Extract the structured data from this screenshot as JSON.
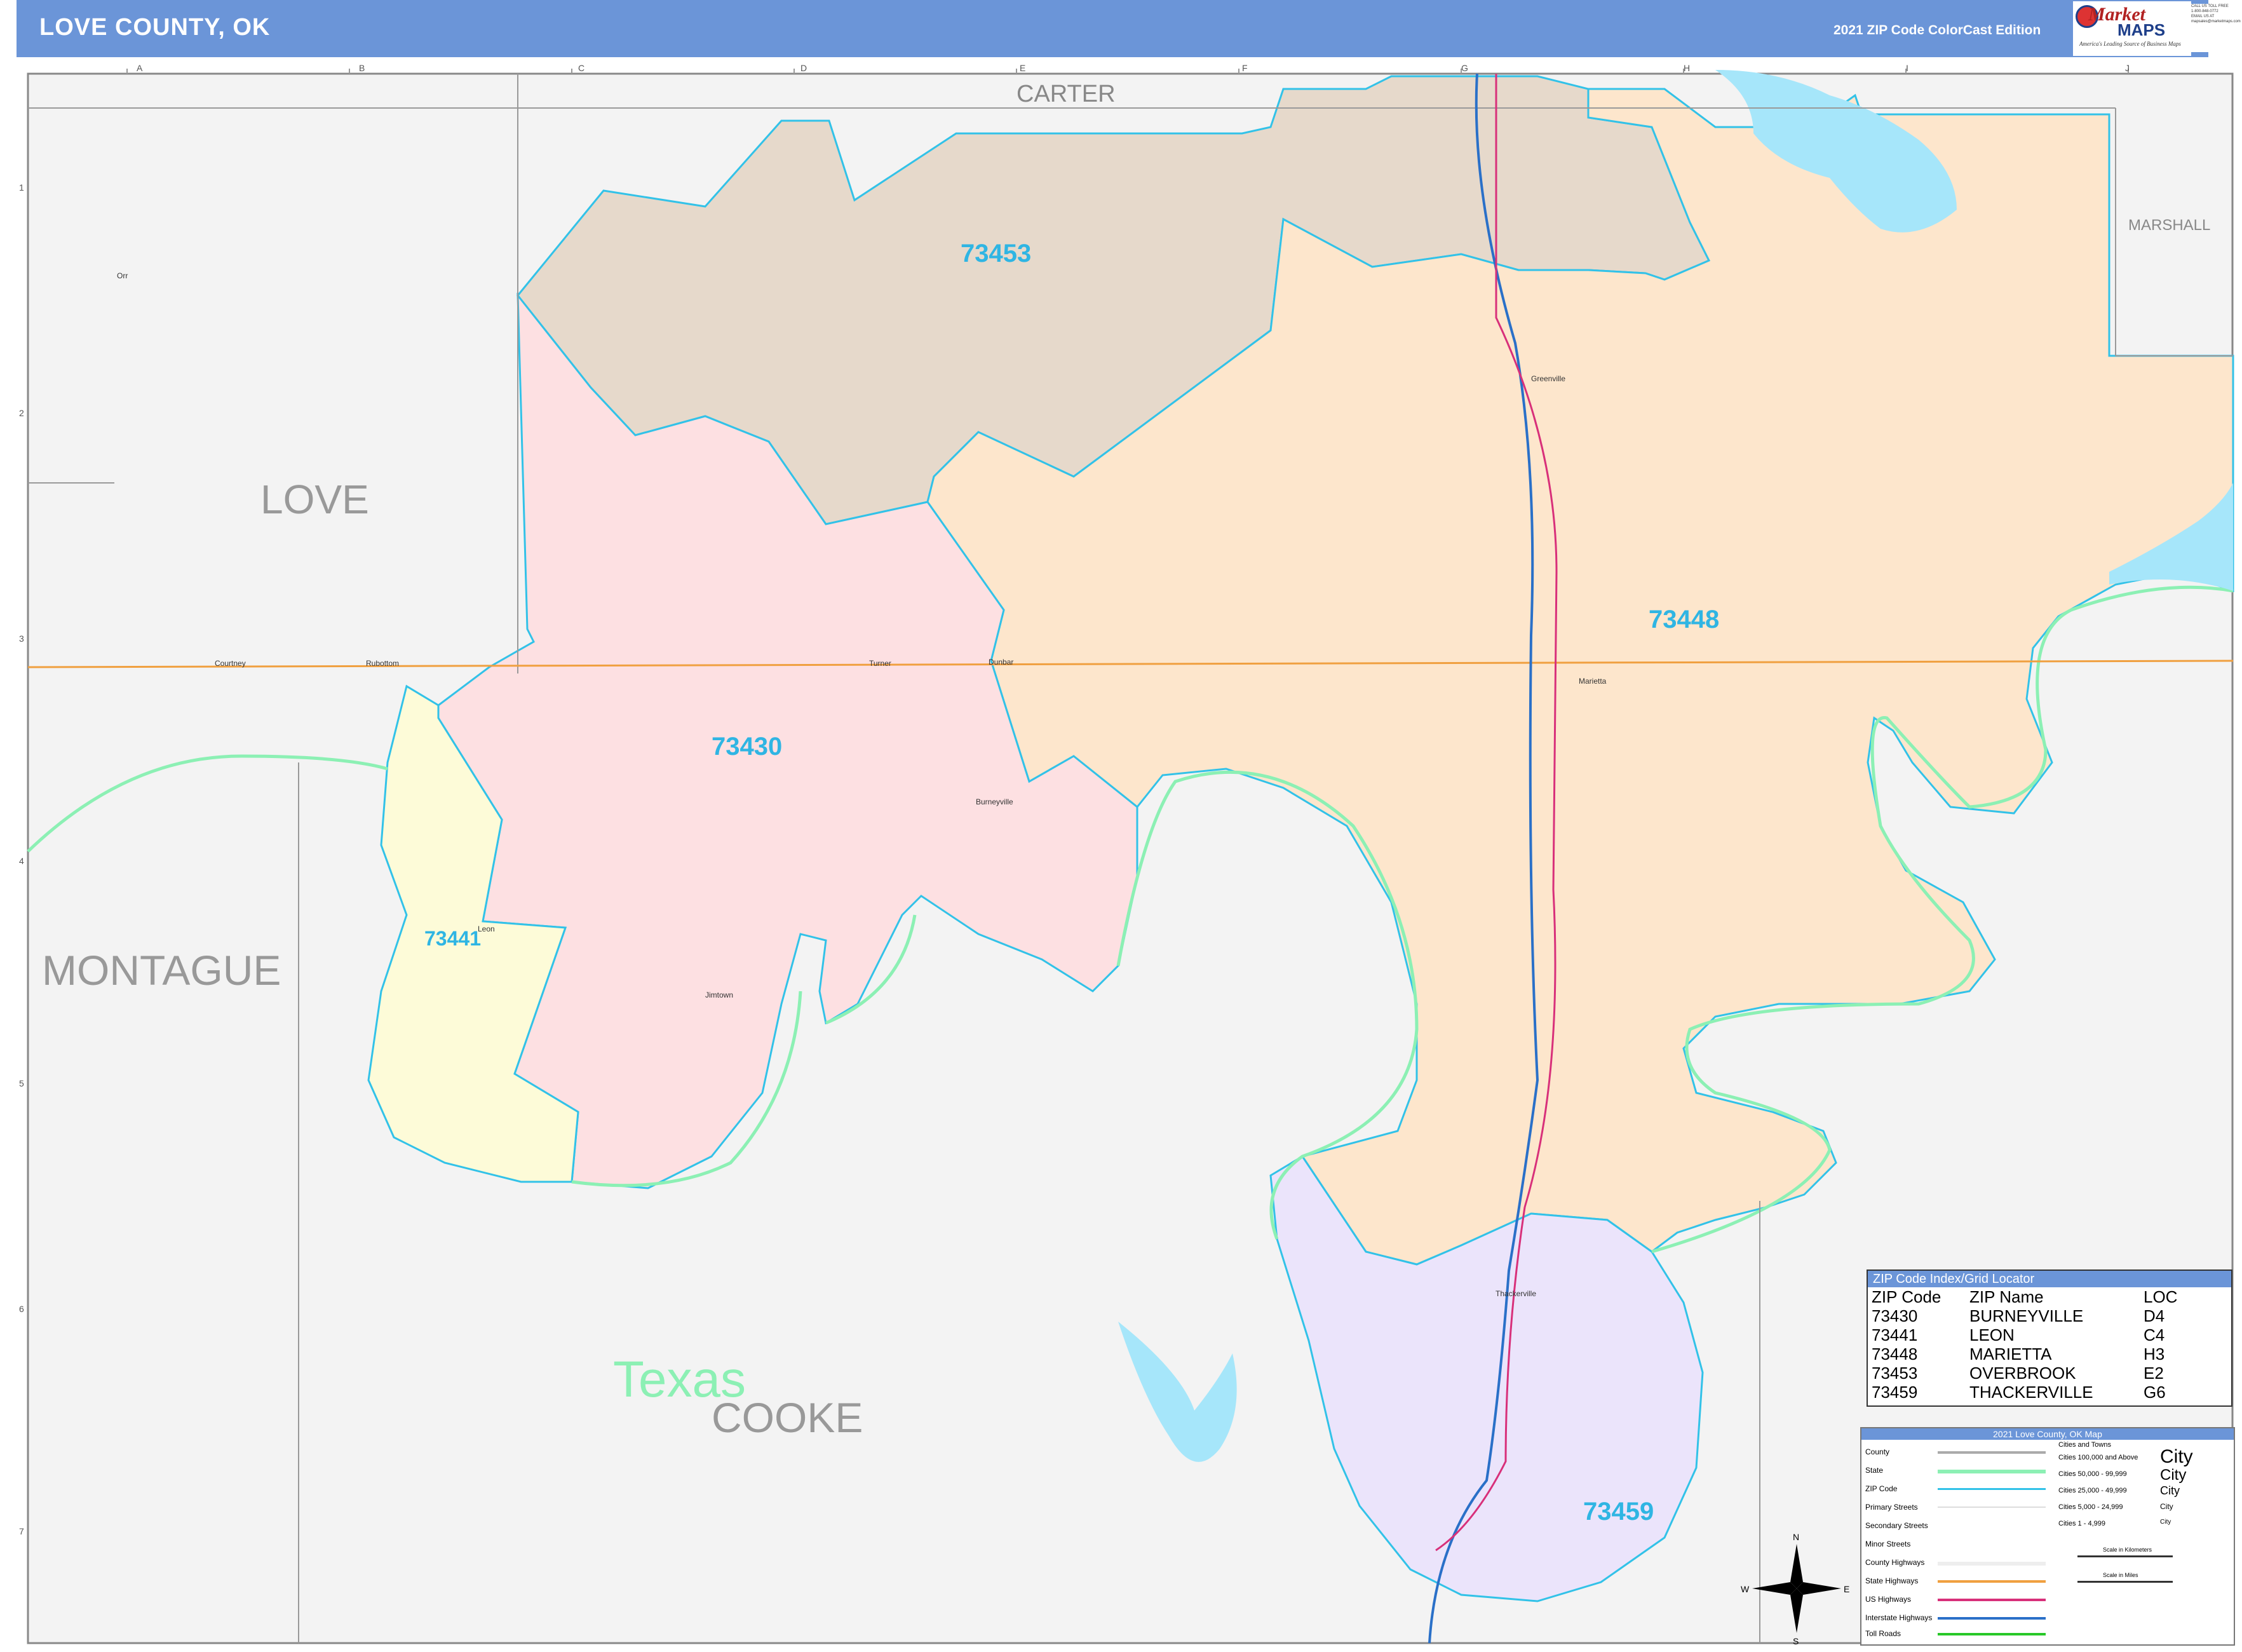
{
  "header": {
    "title": "LOVE COUNTY, OK",
    "edition": "2021 ZIP Code ColorCast Edition",
    "logo_main": "Market",
    "logo_sub": "MAPS",
    "logo_tagline": "America's Leading Source of Business Maps",
    "contact_lines": [
      "CALL US TOLL FREE",
      "1-800-848-0772",
      "EMAIL US AT",
      "mapsales@marketmaps.com"
    ]
  },
  "colors": {
    "header": "#6b95d8",
    "zip_73453": "#e6d9cb",
    "zip_73448": "#fde6cc",
    "zip_73430": "#fde0e2",
    "zip_73441": "#fdfbd8",
    "zip_73459": "#ebe4fb",
    "water": "#a6e6fa",
    "zip_boundary": "#32c2e8",
    "state_boundary": "#8cf0b4",
    "primary_street": "#f0a040",
    "interstate": "#2a70c8",
    "us_highway": "#d8307a"
  },
  "map": {
    "grid_columns": [
      "A",
      "B",
      "C",
      "D",
      "E",
      "F",
      "G",
      "H",
      "I",
      "J"
    ],
    "grid_rows": [
      "1",
      "2",
      "3",
      "4",
      "5",
      "6",
      "7"
    ],
    "county_labels": [
      "CARTER",
      "MARSHALL",
      "LOVE",
      "MONTAGUE",
      "COOKE"
    ],
    "state_label": "Texas",
    "zip_labels": [
      "73453",
      "73448",
      "73430",
      "73441",
      "73459"
    ],
    "place_labels": [
      "Greenville",
      "Marietta",
      "Courtney",
      "Rubottom",
      "Turner",
      "Dunbar",
      "Burneyville",
      "Leon",
      "Jimtown",
      "Thackerville",
      "Orr"
    ],
    "compass": [
      "N",
      "E",
      "S",
      "W"
    ]
  },
  "zip_index": {
    "title": "ZIP Code Index/Grid Locator",
    "headers": [
      "ZIP Code",
      "ZIP Name",
      "LOC"
    ],
    "rows": [
      [
        "73430",
        "BURNEYVILLE",
        "D4"
      ],
      [
        "73441",
        "LEON",
        "C4"
      ],
      [
        "73448",
        "MARIETTA",
        "H3"
      ],
      [
        "73453",
        "OVERBROOK",
        "E2"
      ],
      [
        "73459",
        "THACKERVILLE",
        "G6"
      ]
    ]
  },
  "legend": {
    "title": "2021 Love County, OK Map",
    "items": [
      "County",
      "State",
      "ZIP Code",
      "Primary Streets",
      "Secondary Streets",
      "Minor Streets",
      "County Highways",
      "State Highways",
      "US Highways",
      "Interstate Highways",
      "Toll Roads"
    ],
    "cities_header": "Cities and Towns",
    "city_classes": [
      "Cities 100,000 and Above",
      "Cities 50,000 - 99,999",
      "Cities 25,000 - 49,999",
      "Cities 5,000 - 24,999",
      "Cities 1 - 4,999"
    ],
    "city_marks": [
      "City",
      "City",
      "City",
      "City",
      "City"
    ],
    "scale_km": "Scale in Kilometers",
    "scale_mi": "Scale in Miles"
  }
}
